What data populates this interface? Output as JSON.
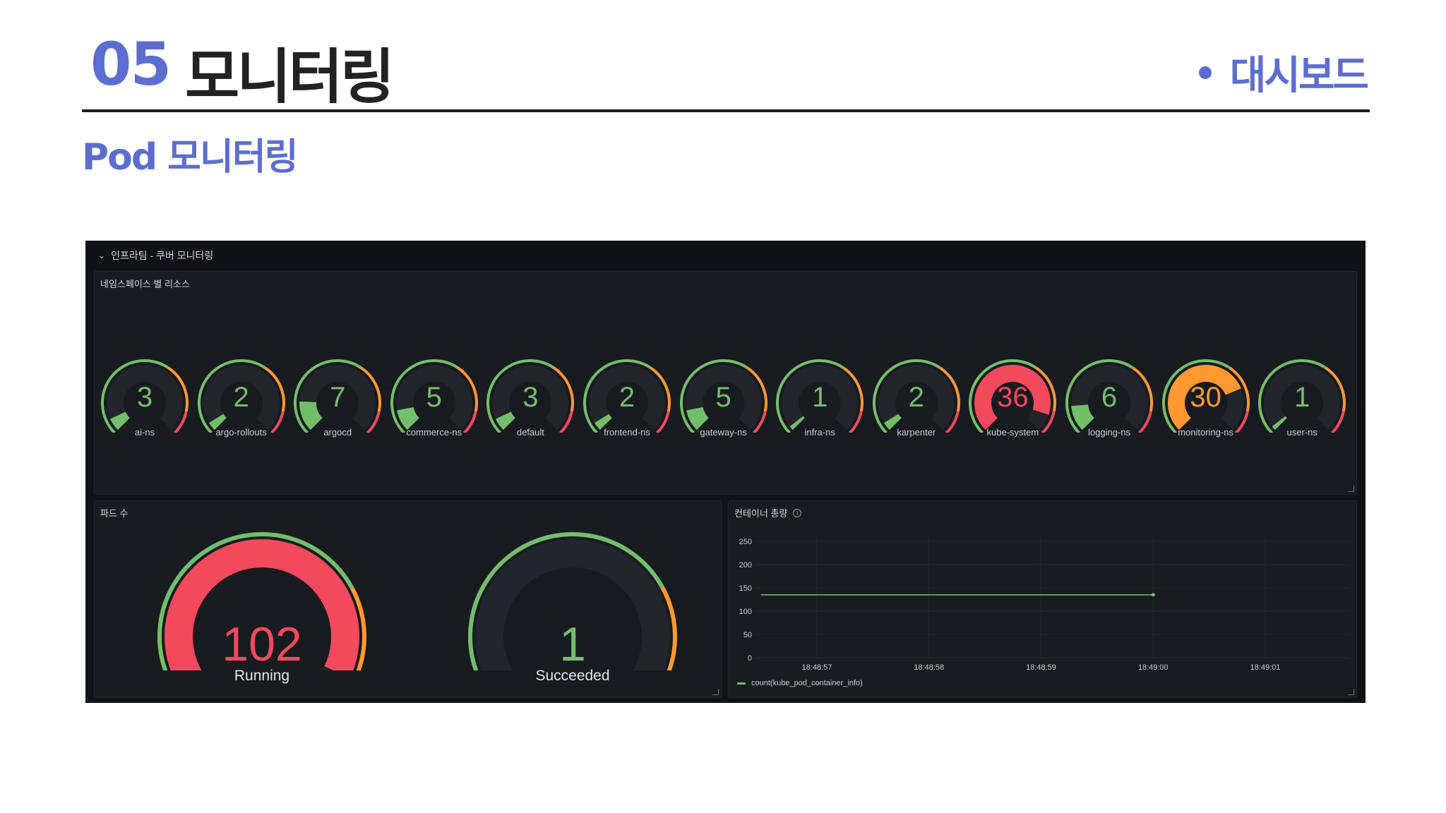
{
  "slide": {
    "section_number": "05",
    "section_title": "모니터링",
    "tag": "대시보드",
    "subtitle": "Pod 모니터링",
    "accent_color": "#5b6ed0"
  },
  "dashboard": {
    "row_title": "인프라팀 - 쿠버 모니터링",
    "namespace_panel": {
      "title": "네임스페이스 별 리소스",
      "gauges": [
        {
          "label": "ai-ns",
          "value": 3
        },
        {
          "label": "argo-rollouts",
          "value": 2
        },
        {
          "label": "argocd",
          "value": 7
        },
        {
          "label": "commerce-ns",
          "value": 5
        },
        {
          "label": "default",
          "value": 3
        },
        {
          "label": "frontend-ns",
          "value": 2
        },
        {
          "label": "gateway-ns",
          "value": 5
        },
        {
          "label": "infra-ns",
          "value": 1
        },
        {
          "label": "karpenter",
          "value": 2
        },
        {
          "label": "kube-system",
          "value": 36
        },
        {
          "label": "logging-ns",
          "value": 6
        },
        {
          "label": "monitoring-ns",
          "value": 30
        },
        {
          "label": "user-ns",
          "value": 1
        }
      ],
      "scale_max": 40,
      "thresholds": [
        {
          "value": 0,
          "color": "#73bf69"
        },
        {
          "value": 25,
          "color": "#ff9830"
        },
        {
          "value": 35,
          "color": "#f2495c"
        }
      ]
    },
    "pod_panel": {
      "title": "파드 수",
      "gauges": [
        {
          "label": "Running",
          "value": 102
        },
        {
          "label": "Succeeded",
          "value": 1
        }
      ],
      "scale_max": 110,
      "thresholds": [
        {
          "value": 0,
          "color": "#73bf69"
        },
        {
          "value": 80,
          "color": "#ff9830"
        },
        {
          "value": 100,
          "color": "#f2495c"
        }
      ]
    },
    "container_panel": {
      "title": "컨테이너 총량",
      "info_icon": "info-icon"
    }
  },
  "chart_data": {
    "type": "line",
    "title": "컨테이너 총량",
    "x": [
      "18:48:56.5",
      "18:49:00"
    ],
    "series": [
      {
        "name": "count(kube_pod_container_info)",
        "values": [
          135,
          135
        ],
        "color": "#73bf69"
      }
    ],
    "x_ticks": [
      "18:48:57",
      "18:48:58",
      "18:48:59",
      "18:49:00",
      "18:49:01"
    ],
    "y_ticks": [
      0,
      50,
      100,
      150,
      200,
      250
    ],
    "ylim": [
      0,
      250
    ],
    "grid": true,
    "legend": "bottom-left"
  }
}
